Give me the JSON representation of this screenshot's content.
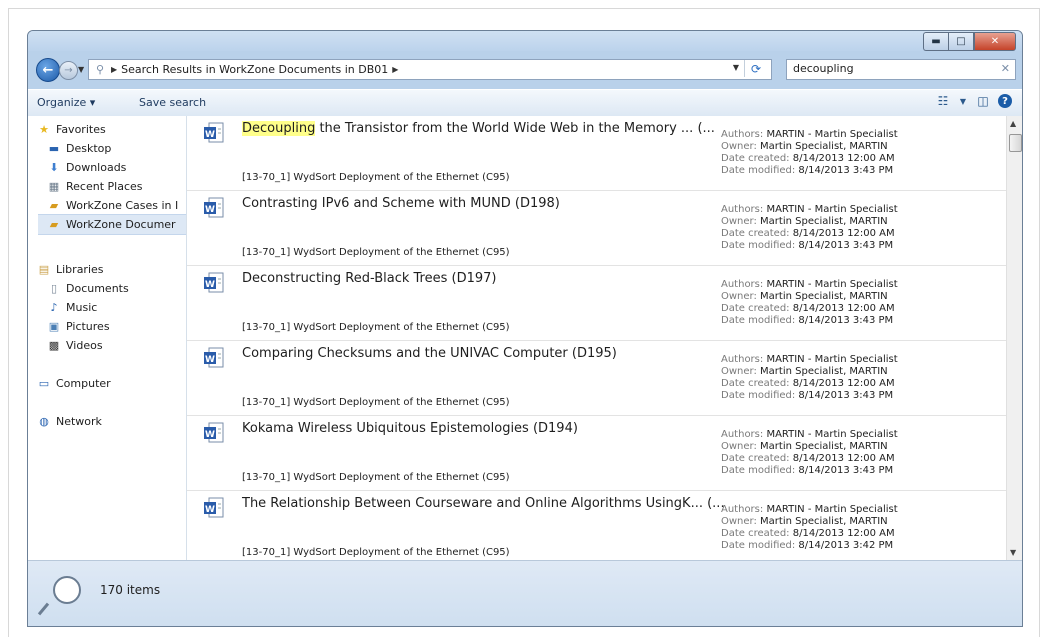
{
  "address": {
    "path": "Search Results in WorkZone Documents in DB01"
  },
  "search": {
    "value": "decoupling"
  },
  "commandbar": {
    "organize": "Organize",
    "save_search": "Save search"
  },
  "navpane": {
    "favorites": "Favorites",
    "desktop": "Desktop",
    "downloads": "Downloads",
    "recent_places": "Recent Places",
    "workzone_cases": "WorkZone Cases in I",
    "workzone_documents": "WorkZone Documer",
    "libraries": "Libraries",
    "documents": "Documents",
    "music": "Music",
    "pictures": "Pictures",
    "videos": "Videos",
    "computer": "Computer",
    "network": "Network"
  },
  "meta_labels": {
    "authors": "Authors:",
    "owner": "Owner:",
    "created": "Date created:",
    "modified": "Date modified:"
  },
  "results": [
    {
      "title_highlight": "Decoupling",
      "title": " the Transistor from the World Wide Web in the Memory ... (...",
      "path": "[13-70_1] WydSort Deployment of the Ethernet (C95)",
      "authors": "MARTIN - Martin Specialist",
      "owner": "Martin Specialist, MARTIN",
      "created": "8/14/2013 12:00 AM",
      "modified": "8/14/2013 3:43 PM"
    },
    {
      "title_highlight": "",
      "title": "Contrasting IPv6 and Scheme with MUND (D198)",
      "path": "[13-70_1] WydSort Deployment of the Ethernet (C95)",
      "authors": "MARTIN - Martin Specialist",
      "owner": "Martin Specialist, MARTIN",
      "created": "8/14/2013 12:00 AM",
      "modified": "8/14/2013 3:43 PM"
    },
    {
      "title_highlight": "",
      "title": "Deconstructing Red-Black Trees (D197)",
      "path": "[13-70_1] WydSort Deployment of the Ethernet (C95)",
      "authors": "MARTIN - Martin Specialist",
      "owner": "Martin Specialist, MARTIN",
      "created": "8/14/2013 12:00 AM",
      "modified": "8/14/2013 3:43 PM"
    },
    {
      "title_highlight": "",
      "title": "Comparing Checksums and the UNIVAC Computer (D195)",
      "path": "[13-70_1] WydSort Deployment of the Ethernet (C95)",
      "authors": "MARTIN - Martin Specialist",
      "owner": "Martin Specialist, MARTIN",
      "created": "8/14/2013 12:00 AM",
      "modified": "8/14/2013 3:43 PM"
    },
    {
      "title_highlight": "",
      "title": "Kokama Wireless Ubiquitous Epistemologies (D194)",
      "path": "[13-70_1] WydSort Deployment of the Ethernet (C95)",
      "authors": "MARTIN - Martin Specialist",
      "owner": "Martin Specialist, MARTIN",
      "created": "8/14/2013 12:00 AM",
      "modified": "8/14/2013 3:43 PM"
    },
    {
      "title_highlight": "",
      "title": "The Relationship Between Courseware and Online Algorithms UsingK... (...",
      "path": "[13-70_1] WydSort Deployment of the Ethernet (C95)",
      "authors": "MARTIN - Martin Specialist",
      "owner": "Martin Specialist, MARTIN",
      "created": "8/14/2013 12:00 AM",
      "modified": "8/14/2013 3:42 PM"
    }
  ],
  "details": {
    "count": "170 items"
  },
  "colors": {
    "highlight": "#ffff8a",
    "frame": "#b9d1ea",
    "accent": "#1a5ca8"
  }
}
